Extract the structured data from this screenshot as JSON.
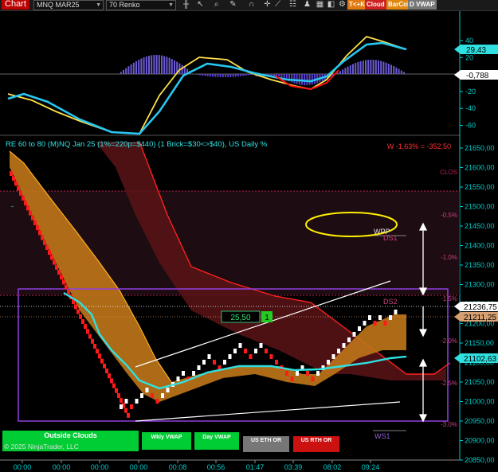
{
  "toolbar": {
    "title": "Chart",
    "instrument": "MNQ MAR25",
    "bar_type": "70 Renko",
    "icons": [
      "bars-icon",
      "cursor-icon",
      "zoom-icon",
      "pencil-icon",
      "magnet-icon",
      "crosshair-icon",
      "draw-icon",
      "properties-icon",
      "strategy-icon",
      "data-icon",
      "layout-icon",
      "gear-icon"
    ],
    "buttons": [
      {
        "label": "T<+K",
        "color": "#e07a10"
      },
      {
        "label": "Cloud",
        "color": "#cc2222"
      },
      {
        "label": "BarCol",
        "color": "#e08810"
      },
      {
        "label": "D VWAP",
        "color": "#777777"
      }
    ]
  },
  "oscillator": {
    "axis_ticks": [
      "40",
      "20",
      "0",
      "-20",
      "-40",
      "-60"
    ],
    "value_high": "29,43",
    "value_low": "-0,788"
  },
  "price_panel": {
    "indicator_label": "RE 60 to 80 (M)NQ Jan 25 (1%=220p=$440) (1 Brick=$30<>$40), US Daily %",
    "weekly_stat": "W -1,63% = -352,50",
    "level_labels": {
      "clos": "CLOS",
      "wpp": "WPP",
      "ds1": "DS1",
      "ds2": "DS2",
      "ws1": "WS1"
    },
    "pct_labels": [
      "-0.5%",
      "-1.0%",
      "-1.5%",
      "-2.0%",
      "-2.5%",
      "-3.0%"
    ],
    "price_ticks": [
      "21650,00",
      "21600,00",
      "21550,00",
      "21500,00",
      "21450,00",
      "21400,00",
      "21350,00",
      "21300,00",
      "21250,00",
      "21200,00",
      "21150,00",
      "21100,00",
      "21050,00",
      "21000,00",
      "20950,00",
      "20900,00",
      "20850,00"
    ],
    "price_markers": {
      "current": "21236,75",
      "ds2": "21211,25",
      "vwap": "21102,63"
    },
    "box_value": "25,50",
    "box_count": "1",
    "time_ticks": [
      "00:00",
      "00:00",
      "00:00",
      "00:00",
      "00:08",
      "00:56",
      "01:47",
      "03:39",
      "08:02",
      "09:24"
    ]
  },
  "bottom_buttons": [
    {
      "label": "Outside Clouds",
      "color": "#00cc33"
    },
    {
      "label": "Wkly VWAP",
      "color": "#00cc33"
    },
    {
      "label": "Day VWAP",
      "color": "#00cc33"
    },
    {
      "label": "US ETH OR",
      "color": "#777777"
    },
    {
      "label": "US RTH OR",
      "color": "#cc1111"
    }
  ],
  "copyright": "© 2025 NinjaTrader, LLC",
  "colors": {
    "macd_pos": "#6b5bd6",
    "macd_neg": "#5a3fd0",
    "fast_line": "#ffe04a",
    "slow_line": "#28c6f0",
    "signal_red": "#ff1111",
    "bull_brick": "#ffffff",
    "bear_brick": "#ff1a1a",
    "cloud_orange": "#c0751a",
    "cloud_red": "#5a1418",
    "grid": "#00cccc"
  }
}
